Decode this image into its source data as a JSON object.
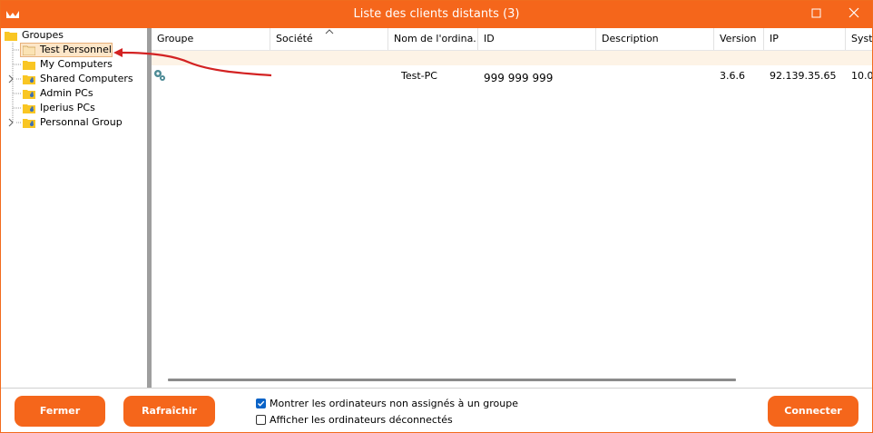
{
  "window": {
    "title": "Liste des clients distants (3)",
    "accent": "#f5661b"
  },
  "tree": {
    "root_label": "Groupes",
    "items": [
      {
        "label": "Test Personnel",
        "selected": true
      },
      {
        "label": "My Computers"
      },
      {
        "label": "Shared Computers",
        "expandable": true
      },
      {
        "label": "Admin PCs"
      },
      {
        "label": "Iperius PCs"
      },
      {
        "label": "Personnal Group",
        "expandable": true
      }
    ]
  },
  "grid": {
    "columns": [
      "Groupe",
      "Société",
      "Nom de l'ordina...",
      "ID",
      "Description",
      "Version",
      "IP",
      "Syste"
    ],
    "rows": [
      {
        "icon": "gear-icon",
        "groupe": "",
        "societe": "",
        "nom": "Test-PC",
        "id": "999 999 999",
        "description": "",
        "version": "3.6.6",
        "ip": "92.139.35.65",
        "systeme": "10.0"
      }
    ]
  },
  "footer": {
    "close_label": "Fermer",
    "refresh_label": "Rafraîchir",
    "connect_label": "Connecter",
    "check_unassigned": {
      "label": "Montrer les ordinateurs non assignés à un groupe",
      "checked": true
    },
    "check_disconnected": {
      "label": "Afficher les ordinateurs déconnectés",
      "checked": false
    }
  }
}
